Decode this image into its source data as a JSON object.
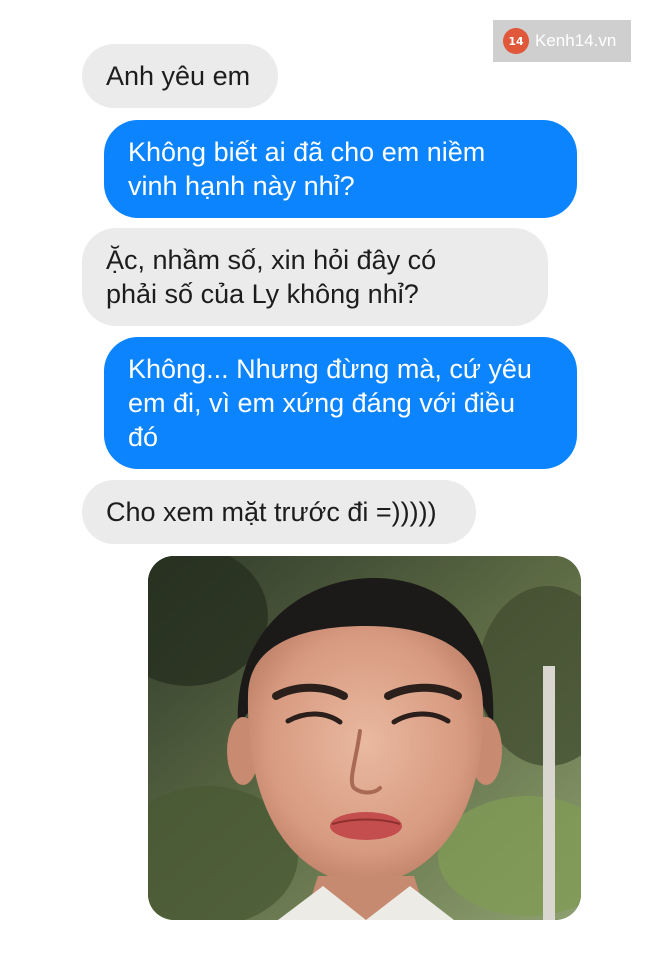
{
  "watermark": {
    "logo_text": "14",
    "site": "Kenh14.vn"
  },
  "messages": [
    {
      "side": "received",
      "text": "Anh yêu em"
    },
    {
      "side": "sent",
      "lines": [
        "Không biết ai đã cho em niềm",
        "vinh hạnh này nhỉ?"
      ]
    },
    {
      "side": "received",
      "lines": [
        "Ặc, nhầm số, xin hỏi đây có",
        "phải số của Ly không nhỉ?"
      ]
    },
    {
      "side": "sent",
      "lines": [
        "Không... Nhưng đừng mà, cứ yêu",
        "em đi, vì em xứng đáng với điều",
        "đó"
      ]
    },
    {
      "side": "received",
      "text": "Cho xem mặt trước đi =)))))"
    }
  ],
  "colors": {
    "sent_bubble": "#0b84fe",
    "received_bubble": "#ebebeb"
  },
  "photo": {
    "icon": "photo-portrait"
  }
}
